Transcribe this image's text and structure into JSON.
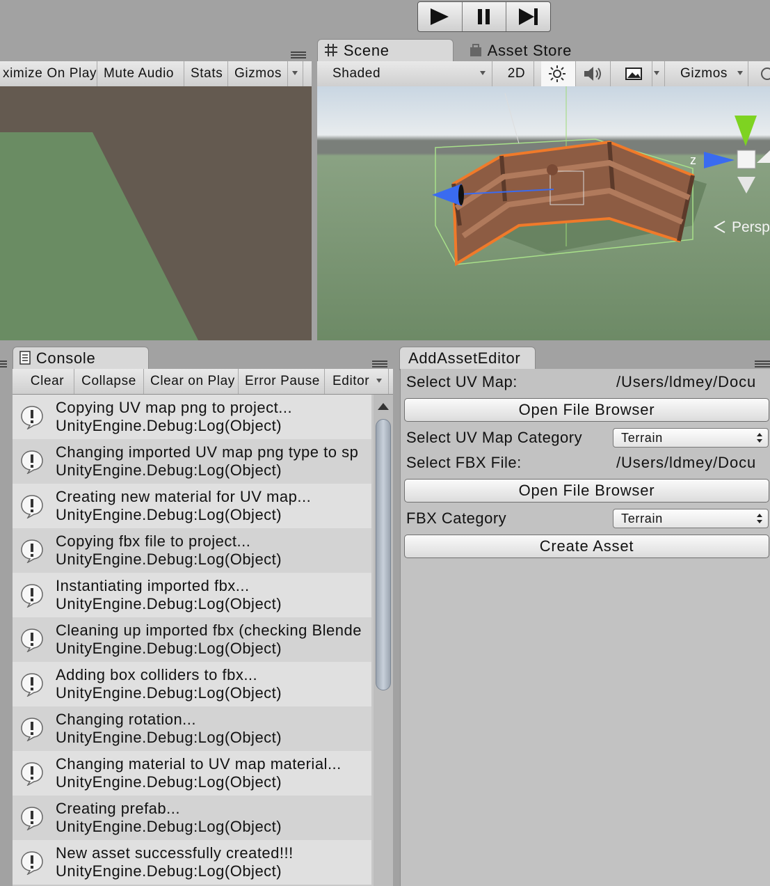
{
  "play_controls": {
    "play_icon": "play-icon",
    "pause_icon": "pause-icon",
    "step_icon": "step-icon"
  },
  "game_view": {
    "toolbar": {
      "maximize_on_play": "ximize On Play",
      "mute_audio": "Mute Audio",
      "stats": "Stats",
      "gizmos": "Gizmos"
    }
  },
  "scene_view": {
    "tabs": {
      "scene": "Scene",
      "asset_store": "Asset Store"
    },
    "toolbar": {
      "shading_mode": "Shaded",
      "mode_2d": "2D",
      "gizmos": "Gizmos"
    },
    "gizmo_axis_label": "z",
    "projection_label": "Persp"
  },
  "console": {
    "tab_label": "Console",
    "toolbar": {
      "clear": "Clear",
      "collapse": "Collapse",
      "clear_on_play": "Clear on Play",
      "error_pause": "Error Pause",
      "editor": "Editor"
    },
    "logs": [
      {
        "message": "Copying UV map png to project...",
        "source": "UnityEngine.Debug:Log(Object)"
      },
      {
        "message": "Changing imported UV map png type to sp",
        "source": "UnityEngine.Debug:Log(Object)"
      },
      {
        "message": "Creating new material for UV map...",
        "source": "UnityEngine.Debug:Log(Object)"
      },
      {
        "message": "Copying fbx file to project...",
        "source": "UnityEngine.Debug:Log(Object)"
      },
      {
        "message": "Instantiating imported fbx...",
        "source": "UnityEngine.Debug:Log(Object)"
      },
      {
        "message": "Cleaning up imported fbx (checking Blende",
        "source": "UnityEngine.Debug:Log(Object)"
      },
      {
        "message": "Adding box colliders to fbx...",
        "source": "UnityEngine.Debug:Log(Object)"
      },
      {
        "message": "Changing rotation...",
        "source": "UnityEngine.Debug:Log(Object)"
      },
      {
        "message": "Changing material to UV map material...",
        "source": "UnityEngine.Debug:Log(Object)"
      },
      {
        "message": "Creating prefab...",
        "source": "UnityEngine.Debug:Log(Object)"
      },
      {
        "message": "New asset successfully created!!!",
        "source": "UnityEngine.Debug:Log(Object)"
      }
    ]
  },
  "add_asset_editor": {
    "tab_label": "AddAssetEditor",
    "select_uv_map_label": "Select UV Map:",
    "uv_map_path": "/Users/ldmey/Docu",
    "open_file_browser_1": "Open File Browser",
    "uv_map_category_label": "Select UV Map Category",
    "uv_map_category_value": "Terrain",
    "select_fbx_label": "Select FBX File:",
    "fbx_path": "/Users/ldmey/Docu",
    "open_file_browser_2": "Open File Browser",
    "fbx_category_label": "FBX Category",
    "fbx_category_value": "Terrain",
    "create_asset": "Create Asset"
  },
  "colors": {
    "panel_bg": "#c2c2c2",
    "window_bg": "#a2a2a2",
    "selection_orange": "#f07a2a",
    "axis_blue": "#3a6bf0",
    "axis_green": "#7ed321"
  }
}
